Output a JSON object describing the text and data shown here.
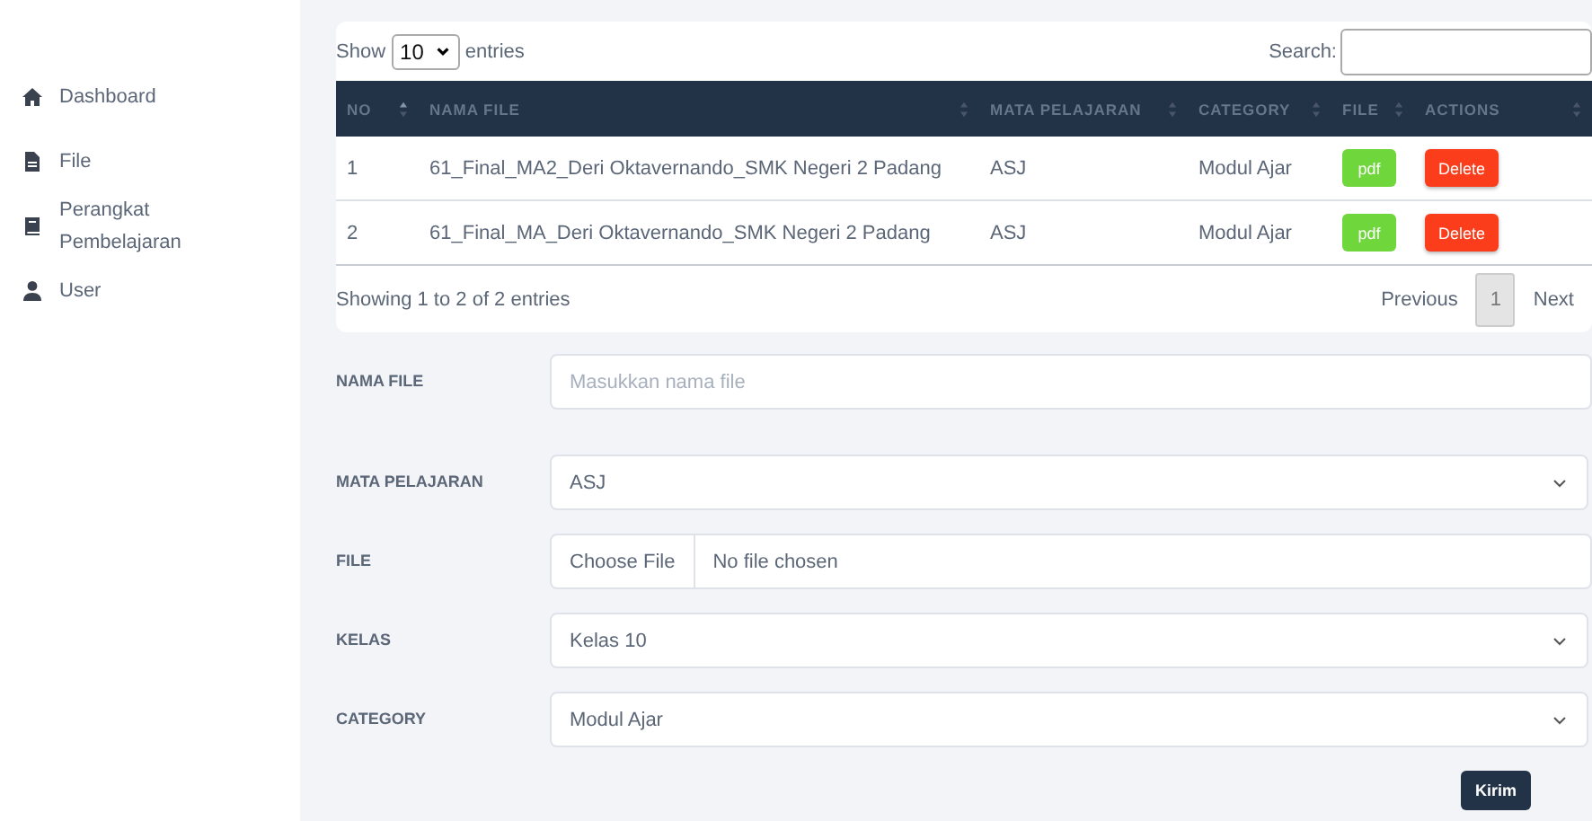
{
  "sidebar": {
    "items": [
      {
        "label": "Dashboard",
        "kind": "home",
        "selected": false
      },
      {
        "label": "File",
        "kind": "file",
        "selected": false
      },
      {
        "label": "Perangkat Pembelajaran",
        "kind": "book",
        "selected": false
      },
      {
        "label": "User",
        "kind": "user",
        "selected": false
      }
    ]
  },
  "table": {
    "length_label_before": "Show",
    "length_value": "10",
    "length_label_after": "entries",
    "search_label": "Search:",
    "columns": [
      {
        "label": "NO",
        "sorted": true
      },
      {
        "label": "NAMA FILE",
        "sorted": false
      },
      {
        "label": "MATA PELAJARAN",
        "sorted": false
      },
      {
        "label": "CATEGORY",
        "sorted": false
      },
      {
        "label": "FILE",
        "sorted": false
      },
      {
        "label": "ACTIONS",
        "sorted": false
      }
    ],
    "rows": [
      {
        "no": "1",
        "nama_file": "61_Final_MA2_Deri Oktavernando_SMK Negeri 2 Padang",
        "mata_pelajaran": "ASJ",
        "category": "Modul Ajar",
        "file_button": "pdf",
        "action_button": "Delete"
      },
      {
        "no": "2",
        "nama_file": "61_Final_MA_Deri Oktavernando_SMK Negeri 2 Padang",
        "mata_pelajaran": "ASJ",
        "category": "Modul Ajar",
        "file_button": "pdf",
        "action_button": "Delete"
      }
    ],
    "info": "Showing 1 to 2 of 2 entries",
    "pagination": [
      {
        "label": "Previous",
        "kind": "link",
        "selected": false
      },
      {
        "label": "1",
        "kind": "page",
        "selected": true
      },
      {
        "label": "Next",
        "kind": "link",
        "selected": false
      }
    ]
  },
  "form": {
    "fields": [
      {
        "label": "NAMA FILE",
        "kind": "text",
        "placeholder": "Masukkan nama file"
      },
      {
        "label": "MATA PELAJARAN",
        "kind": "select",
        "value": "ASJ"
      },
      {
        "label": "FILE",
        "kind": "file",
        "button": "Choose File",
        "value": "No file chosen"
      },
      {
        "label": "KELAS",
        "kind": "select",
        "value": "Kelas 10"
      },
      {
        "label": "CATEGORY",
        "kind": "select",
        "value": "Modul Ajar"
      }
    ],
    "submit": "Kirim"
  }
}
